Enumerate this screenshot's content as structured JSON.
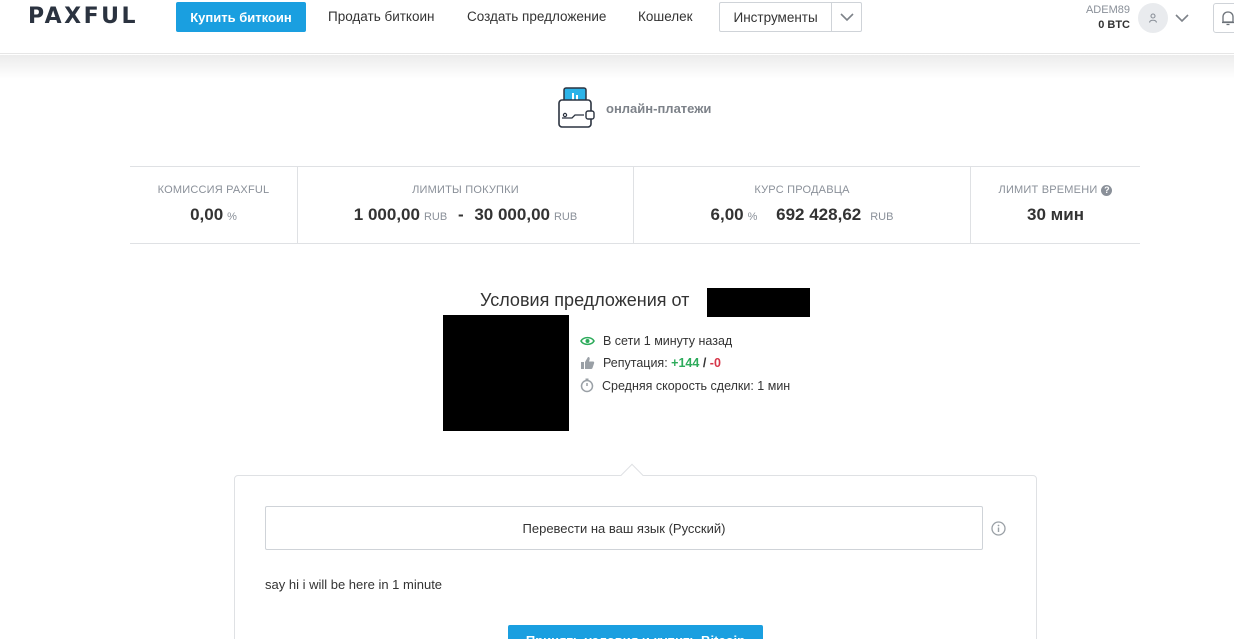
{
  "header": {
    "logo": "PAXFUL",
    "nav": {
      "buy": "Купить биткоин",
      "sell": "Продать биткоин",
      "create_offer": "Создать предложение",
      "wallet": "Кошелек",
      "tools": "Инструменты"
    },
    "user": {
      "name": "ADEM89",
      "balance": "0 BTC"
    }
  },
  "payment_method": {
    "label": "онлайн-платежи",
    "icon": "wallet-icon"
  },
  "stats": {
    "fee": {
      "label": "КОМИССИЯ PAXFUL",
      "value": "0,00",
      "unit": "%"
    },
    "limits": {
      "label": "ЛИМИТЫ ПОКУПКИ",
      "min": "1 000,00",
      "min_unit": "RUB",
      "separator": "-",
      "max": "30 000,00",
      "max_unit": "RUB"
    },
    "rate": {
      "label": "КУРС ПРОДАВЦА",
      "margin": "6,00",
      "margin_unit": "%",
      "price": "692 428,62",
      "price_unit": "RUB"
    },
    "time_limit": {
      "label": "ЛИМИТ ВРЕМЕНИ",
      "help": "?",
      "value": "30 мин"
    }
  },
  "offer": {
    "title": "Условия предложения от",
    "online": "В сети 1 минуту назад",
    "reputation_label": "Репутация:",
    "reputation_positive": "+144",
    "reputation_sep": "/",
    "reputation_negative": "-0",
    "avg_speed": "Средняя скорость сделки: 1 мин"
  },
  "terms": {
    "translate_button": "Перевести на ваш язык (Русский)",
    "text": "say hi i will be here in 1 minute",
    "cta": "Принять условия и купить Bitcoin"
  },
  "colors": {
    "accent": "#1a9fe0",
    "positive": "#2dab5b",
    "negative": "#d63548"
  }
}
